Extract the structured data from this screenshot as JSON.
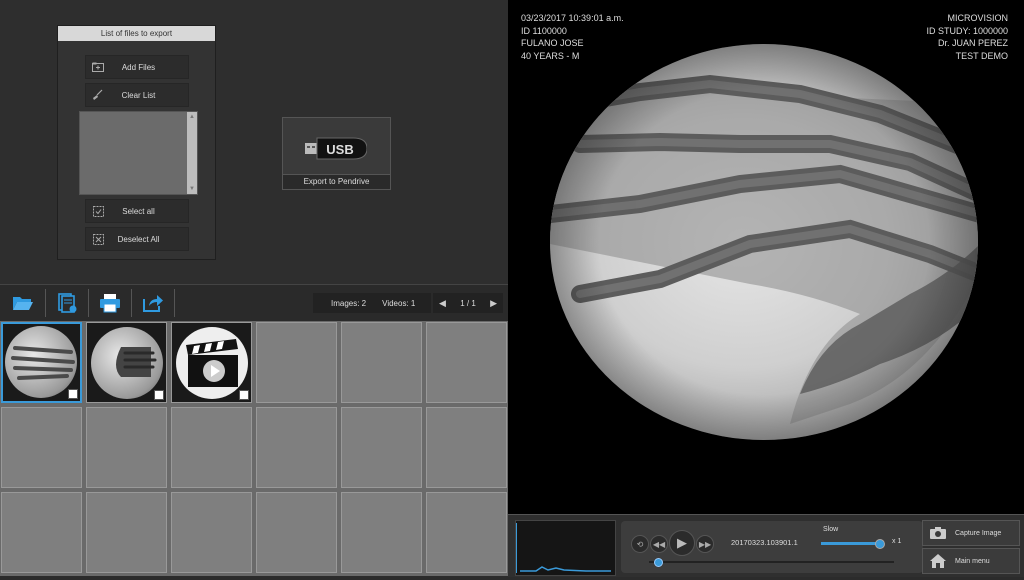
{
  "export_panel": {
    "title": "List of files to export",
    "add_files": "Add Files",
    "clear_list": "Clear List",
    "select_all": "Select all",
    "deselect_all": "Deselect All"
  },
  "usb": {
    "logo_text": "USB",
    "label": "Export to Pendrive"
  },
  "toolbar": {
    "images_count": "Images: 2",
    "videos_count": "Videos: 1",
    "page": "1 / 1"
  },
  "overlay": {
    "left": [
      "03/23/2017 10:39:01 a.m.",
      "ID 1100000",
      "FULANO JOSE",
      "40 YEARS - M"
    ],
    "right": [
      "MICROVISION",
      "ID STUDY:  1000000",
      "Dr. JUAN PEREZ",
      "TEST DEMO"
    ]
  },
  "player": {
    "filename": "20170323.103901.1",
    "speed_label": "Slow",
    "speed_value": "x 1",
    "progress": 0.02,
    "speed_level": 0.9
  },
  "right_buttons": {
    "capture": "Capture Image",
    "menu": "Main menu"
  },
  "colors": {
    "accent": "#3a9ad9",
    "icon_blue": "#2f9ae0"
  }
}
